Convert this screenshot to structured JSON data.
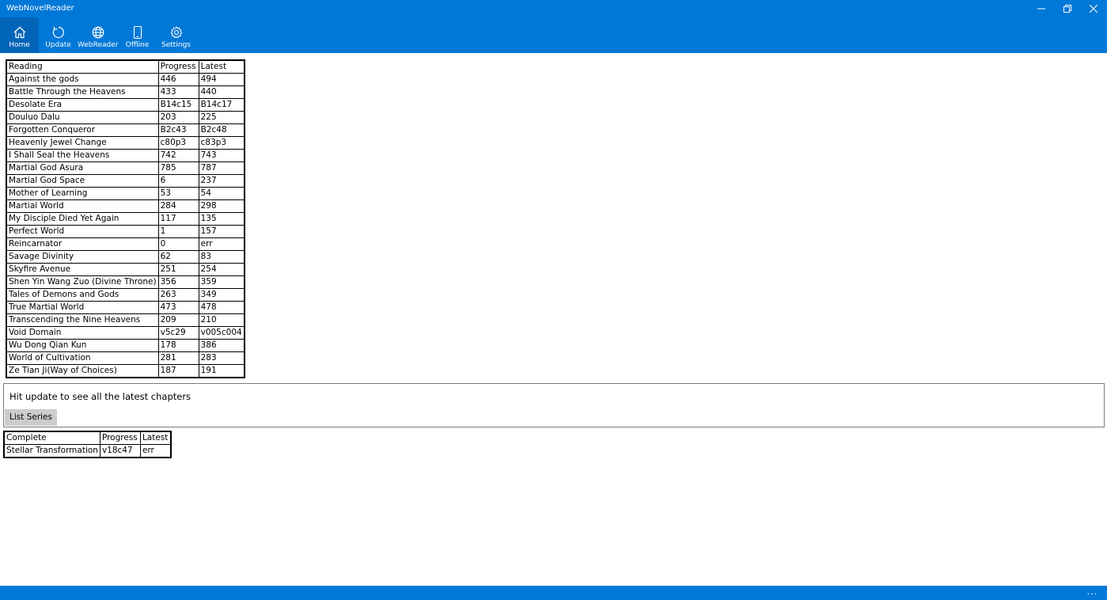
{
  "window": {
    "title": "WebNovelReader"
  },
  "nav": {
    "items": [
      {
        "label": "Home",
        "icon": "home-icon"
      },
      {
        "label": "Update",
        "icon": "refresh-icon"
      },
      {
        "label": "WebReader",
        "icon": "globe-icon"
      },
      {
        "label": "Offline",
        "icon": "phone-icon"
      },
      {
        "label": "Settings",
        "icon": "gear-icon"
      }
    ],
    "active": "Home"
  },
  "reading_table": {
    "headers": [
      "Reading",
      "Progress",
      "Latest"
    ],
    "rows": [
      [
        "Against the gods",
        "446",
        "494"
      ],
      [
        "Battle Through the Heavens",
        "433",
        "440"
      ],
      [
        "Desolate Era",
        "B14c15",
        "B14c17"
      ],
      [
        "Douluo Dalu",
        "203",
        "225"
      ],
      [
        "Forgotten Conqueror",
        "B2c43",
        "B2c48"
      ],
      [
        "Heavenly Jewel Change",
        "c80p3",
        "c83p3"
      ],
      [
        "I Shall Seal the Heavens",
        "742",
        "743"
      ],
      [
        "Martial God Asura",
        "785",
        "787"
      ],
      [
        "Martial God Space",
        "6",
        "237"
      ],
      [
        "Mother of Learning",
        "53",
        "54"
      ],
      [
        "Martial World",
        "284",
        "298"
      ],
      [
        "My Disciple Died Yet Again",
        "117",
        "135"
      ],
      [
        "Perfect World",
        "1",
        "157"
      ],
      [
        "Reincarnator",
        "0",
        "err"
      ],
      [
        "Savage Divinity",
        "62",
        "83"
      ],
      [
        "Skyfire Avenue",
        "251",
        "254"
      ],
      [
        "Shen Yin Wang Zuo (Divine Throne)",
        "356",
        "359"
      ],
      [
        "Tales of Demons and Gods",
        "263",
        "349"
      ],
      [
        "True Martial World",
        "473",
        "478"
      ],
      [
        "Transcending the Nine Heavens",
        "209",
        "210"
      ],
      [
        "Void Domain",
        "v5c29",
        "v005c004"
      ],
      [
        "Wu Dong Qian Kun",
        "178",
        "386"
      ],
      [
        "World of Cultivation",
        "281",
        "283"
      ],
      [
        "Ze Tian Ji(Way of Choices)",
        "187",
        "191"
      ]
    ]
  },
  "info": {
    "message": "Hit update to see all the latest chapters",
    "list_button": "List Series"
  },
  "complete_table": {
    "headers": [
      "Complete",
      "Progress",
      "Latest"
    ],
    "rows": [
      [
        "Stellar Transformation",
        "v18c47",
        "err"
      ]
    ]
  },
  "statusbar": {
    "more_label": "..."
  },
  "colors": {
    "accent": "#0078d7",
    "nav_active": "#0064b8",
    "button_bg": "#cccccc"
  }
}
